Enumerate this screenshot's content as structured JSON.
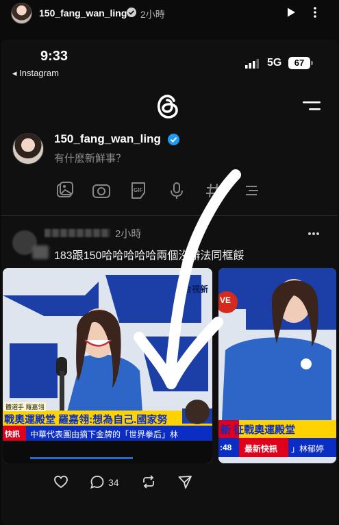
{
  "story": {
    "username": "150_fang_wan_ling",
    "time": "2小時"
  },
  "phone_status": {
    "time": "9:33",
    "back_label": "◂ Instagram",
    "network": "5G",
    "battery": "67"
  },
  "composer": {
    "username": "150_fang_wan_ling",
    "placeholder": "有什麼新鮮事？",
    "tools": [
      "image-icon",
      "camera-icon",
      "gif-icon",
      "mic-icon",
      "hashtag-icon",
      "list-icon"
    ]
  },
  "post": {
    "time": "2小時",
    "text": "183跟150哈哈哈哈哈兩個沒辦法同框餒",
    "reply_count": "34",
    "media": [
      {
        "station": "台視新",
        "caption_small": "體選手 羅嘉翎",
        "headline": "戰奧運殿堂 羅嘉翎:想為自己.國家努",
        "ticker_label": "快訊",
        "ticker_text": "中華代表團由摘下金牌的「世界拳后」林"
      },
      {
        "badge": "VE",
        "headline": "新 征戰奧運殿堂",
        "ticker_time": ":48",
        "ticker_label": "最新快訊",
        "ticker_text": "」林郁婷"
      }
    ]
  },
  "colors": {
    "background": "#0b0b0b",
    "verified": "#1d9bf0",
    "news_yellow": "#ffd200",
    "news_blue": "#0a2ec4",
    "news_red": "#e0001b",
    "jersey": "#2f6fd0"
  }
}
